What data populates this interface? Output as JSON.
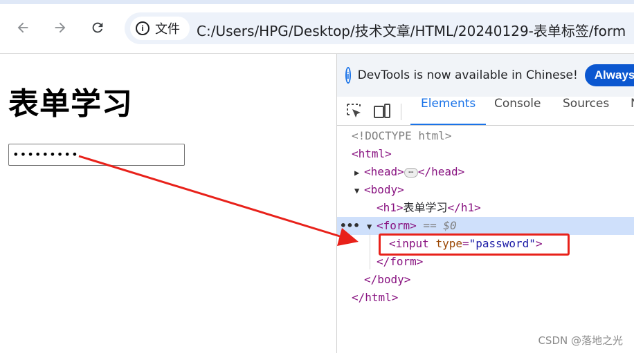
{
  "browser": {
    "site_chip_label": "文件",
    "url": "C:/Users/HPG/Desktop/技术文章/HTML/20240129-表单标签/form"
  },
  "page": {
    "heading": "表单学习",
    "password_masked": "•••••••••"
  },
  "devtools": {
    "banner_text": "DevTools is now available in Chinese!",
    "banner_button": "Always m",
    "tabs": [
      "Elements",
      "Console",
      "Sources",
      "N"
    ],
    "active_tab": "Elements",
    "tree": {
      "doctype": "<!DOCTYPE html>",
      "html_open": "<html>",
      "head_open": "<head>",
      "head_close": "</head>",
      "body_open": "<body>",
      "h1_open": "<h1>",
      "h1_text": "表单学习",
      "h1_close": "</h1>",
      "form_open": "<form>",
      "selected_marker": " == $0",
      "input_tag": "<input ",
      "input_attr_name": "type",
      "input_attr_value": "\"password\"",
      "input_close": ">",
      "form_close": "</form>",
      "body_close": "</body>",
      "html_close": "</html>"
    }
  },
  "watermark": "CSDN @落地之光",
  "colors": {
    "accent": "#1a73e8",
    "annotation_red": "#e8211a",
    "selected_row": "#cfe0fb"
  }
}
